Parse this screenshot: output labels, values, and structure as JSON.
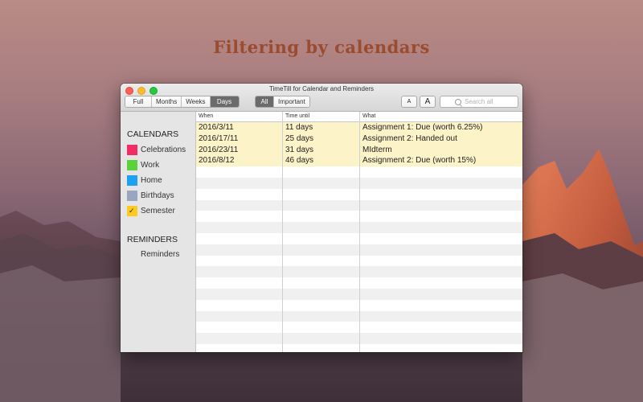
{
  "headline": "Filtering by calendars",
  "window": {
    "title": "TimeTill for Calendar and Reminders"
  },
  "toolbar": {
    "range_buttons": [
      {
        "label": "Full",
        "selected": false
      },
      {
        "label": "Months",
        "selected": false
      },
      {
        "label": "Weeks",
        "selected": false
      },
      {
        "label": "Days",
        "selected": true
      }
    ],
    "filter_buttons": [
      {
        "label": "All",
        "selected": true
      },
      {
        "label": "Important",
        "selected": false
      }
    ],
    "font_small_label": "A",
    "font_large_label": "A",
    "search_placeholder": "Search all"
  },
  "sidebar": {
    "calendars_header": "CALENDARS",
    "calendars": [
      {
        "label": "Celebrations",
        "color": "#f02d64",
        "checked": false
      },
      {
        "label": "Work",
        "color": "#5bd13c",
        "checked": false
      },
      {
        "label": "Home",
        "color": "#1da1f2",
        "checked": false
      },
      {
        "label": "Birthdays",
        "color": "#98a6bf",
        "checked": false
      },
      {
        "label": "Semester",
        "color": "#fccb1d",
        "checked": true
      }
    ],
    "reminders_header": "REMINDERS",
    "reminders": [
      {
        "label": "Reminders"
      }
    ]
  },
  "table": {
    "columns": [
      "When",
      "Time until",
      "What"
    ],
    "rows": [
      {
        "when": "2016/3/11",
        "until": "11 days",
        "what": "Assignment 1: Due (worth 6.25%)"
      },
      {
        "when": "2016/17/11",
        "until": "25 days",
        "what": "Assignment 2: Handed out"
      },
      {
        "when": "2016/23/11",
        "until": "31 days",
        "what": "MIdterm"
      },
      {
        "when": "2016/8/12",
        "until": "46 days",
        "what": "Assignment 2: Due (worth 15%)"
      }
    ]
  },
  "colors": {
    "highlight_row": "#fdf3c8",
    "selected_segment": "#6b6b6b"
  }
}
